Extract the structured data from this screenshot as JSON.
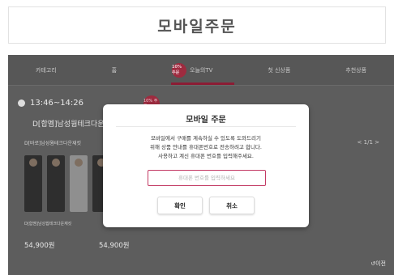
{
  "header": {
    "title": "모바일주문"
  },
  "nav": {
    "items": [
      {
        "label": "카테고리"
      },
      {
        "label": "홈"
      },
      {
        "label": "오늘의TV",
        "badge": "10% 주문",
        "active": true
      },
      {
        "label": "첫 신상품"
      },
      {
        "label": "추천상품"
      }
    ]
  },
  "broadcast": {
    "time": "13:46~14:26",
    "product_title": "D[합멤]남성웜테크다운",
    "badge": "10% 주문"
  },
  "list": {
    "title": "D[바로]남성웜테크다운재킷",
    "pager": "< 1/1 >",
    "caption": "D[합멤]남성웜테크다운재킷",
    "price1": "54,900원",
    "price2": "54,900원",
    "back": "↺이전"
  },
  "modal": {
    "title": "모바일 주문",
    "message_line1": "모바일에서 구매를 계속하실 수 있도록 도와드리기",
    "message_line2": "위해 상품 안내를 휴대폰번호로 전송하려고 합니다.",
    "message_line3": "사용하고 계신 휴대폰 번호를 입력해주세요.",
    "input_placeholder": "휴대폰 번호를 입력하세요",
    "input_value": "",
    "ok_label": "확인",
    "cancel_label": "취소"
  },
  "colors": {
    "accent": "#c33a64",
    "overlay": "#5d5d5d"
  }
}
